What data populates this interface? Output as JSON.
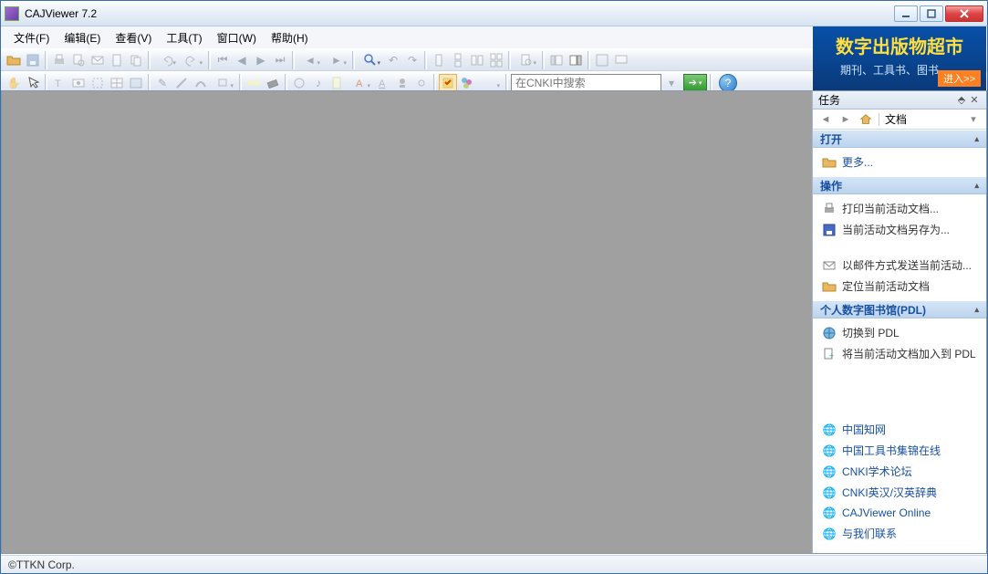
{
  "window": {
    "title": "CAJViewer 7.2"
  },
  "menu": {
    "file": "文件(F)",
    "edit": "编辑(E)",
    "view": "查看(V)",
    "tools": "工具(T)",
    "window": "窗口(W)",
    "help": "帮助(H)"
  },
  "search": {
    "placeholder": "在CNKI中搜索"
  },
  "banner": {
    "title": "数字出版物超市",
    "subtitle": "期刊、工具书、图书、...",
    "enter": "进入>>"
  },
  "taskpane": {
    "title": "任务",
    "nav_label": "文档",
    "sections": {
      "open": {
        "title": "打开",
        "more": "更多..."
      },
      "ops": {
        "title": "操作",
        "print": "打印当前活动文档...",
        "saveas": "当前活动文档另存为...",
        "mail": "以邮件方式发送当前活动...",
        "locate": "定位当前活动文档"
      },
      "pdl": {
        "title": "个人数字图书馆(PDL)",
        "switch": "切换到 PDL",
        "add": "将当前活动文档加入到 PDL"
      }
    },
    "links": {
      "cnki": "中国知网",
      "tools": "中国工具书集锦在线",
      "forum": "CNKI学术论坛",
      "dict": "CNKI英汉/汉英辞典",
      "online": "CAJViewer Online",
      "contact": "与我们联系"
    }
  },
  "status": {
    "copyright": "©TTKN Corp."
  }
}
